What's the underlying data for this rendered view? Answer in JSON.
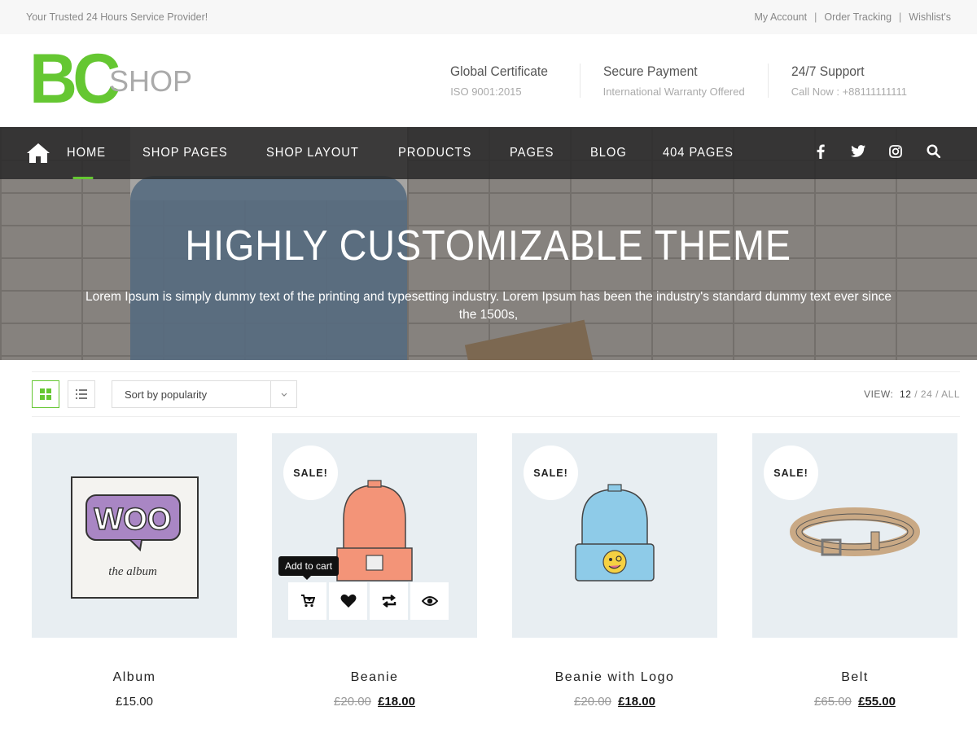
{
  "topbar": {
    "tagline": "Your Trusted 24 Hours Service Provider!",
    "links": [
      "My Account",
      "Order Tracking",
      "Wishlist's"
    ],
    "separator": "|"
  },
  "logo": {
    "mark": "BC",
    "word": "SHOP",
    "accent": "#65c732"
  },
  "features": [
    {
      "title": "Global Certificate",
      "subtitle": "ISO 9001:2015"
    },
    {
      "title": "Secure Payment",
      "subtitle": "International Warranty Offered"
    },
    {
      "title": "24/7 Support",
      "subtitle": "Call Now : +88111111111"
    }
  ],
  "nav": {
    "home_icon": "home-icon",
    "items": [
      "HOME",
      "SHOP PAGES",
      "SHOP LAYOUT",
      "PRODUCTS",
      "PAGES",
      "BLOG",
      "404 PAGES"
    ],
    "active": "HOME",
    "social": [
      "facebook-icon",
      "twitter-icon",
      "instagram-icon",
      "search-icon"
    ]
  },
  "hero": {
    "title": "HIGHLY CUSTOMIZABLE THEME",
    "text": "Lorem Ipsum is simply dummy text of the printing and typesetting industry. Lorem Ipsum has been the industry's standard dummy text ever since the 1500s,"
  },
  "toolbar": {
    "sort_label": "Sort by popularity",
    "view_label": "VIEW:",
    "view_options": [
      "12",
      "24",
      "ALL"
    ],
    "view_selected": "12",
    "slash": "/"
  },
  "products": [
    {
      "name": "Album",
      "price": "£15.00",
      "old_price": "",
      "sale": ""
    },
    {
      "name": "Beanie",
      "price": "£18.00",
      "old_price": "£20.00",
      "sale": "SALE!"
    },
    {
      "name": "Beanie with Logo",
      "price": "£18.00",
      "old_price": "£20.00",
      "sale": "SALE!"
    },
    {
      "name": "Belt",
      "price": "£55.00",
      "old_price": "£65.00",
      "sale": "SALE!"
    }
  ],
  "tooltip": "Add to cart",
  "album_art": {
    "logo_text": "WOO",
    "caption": "the album"
  }
}
